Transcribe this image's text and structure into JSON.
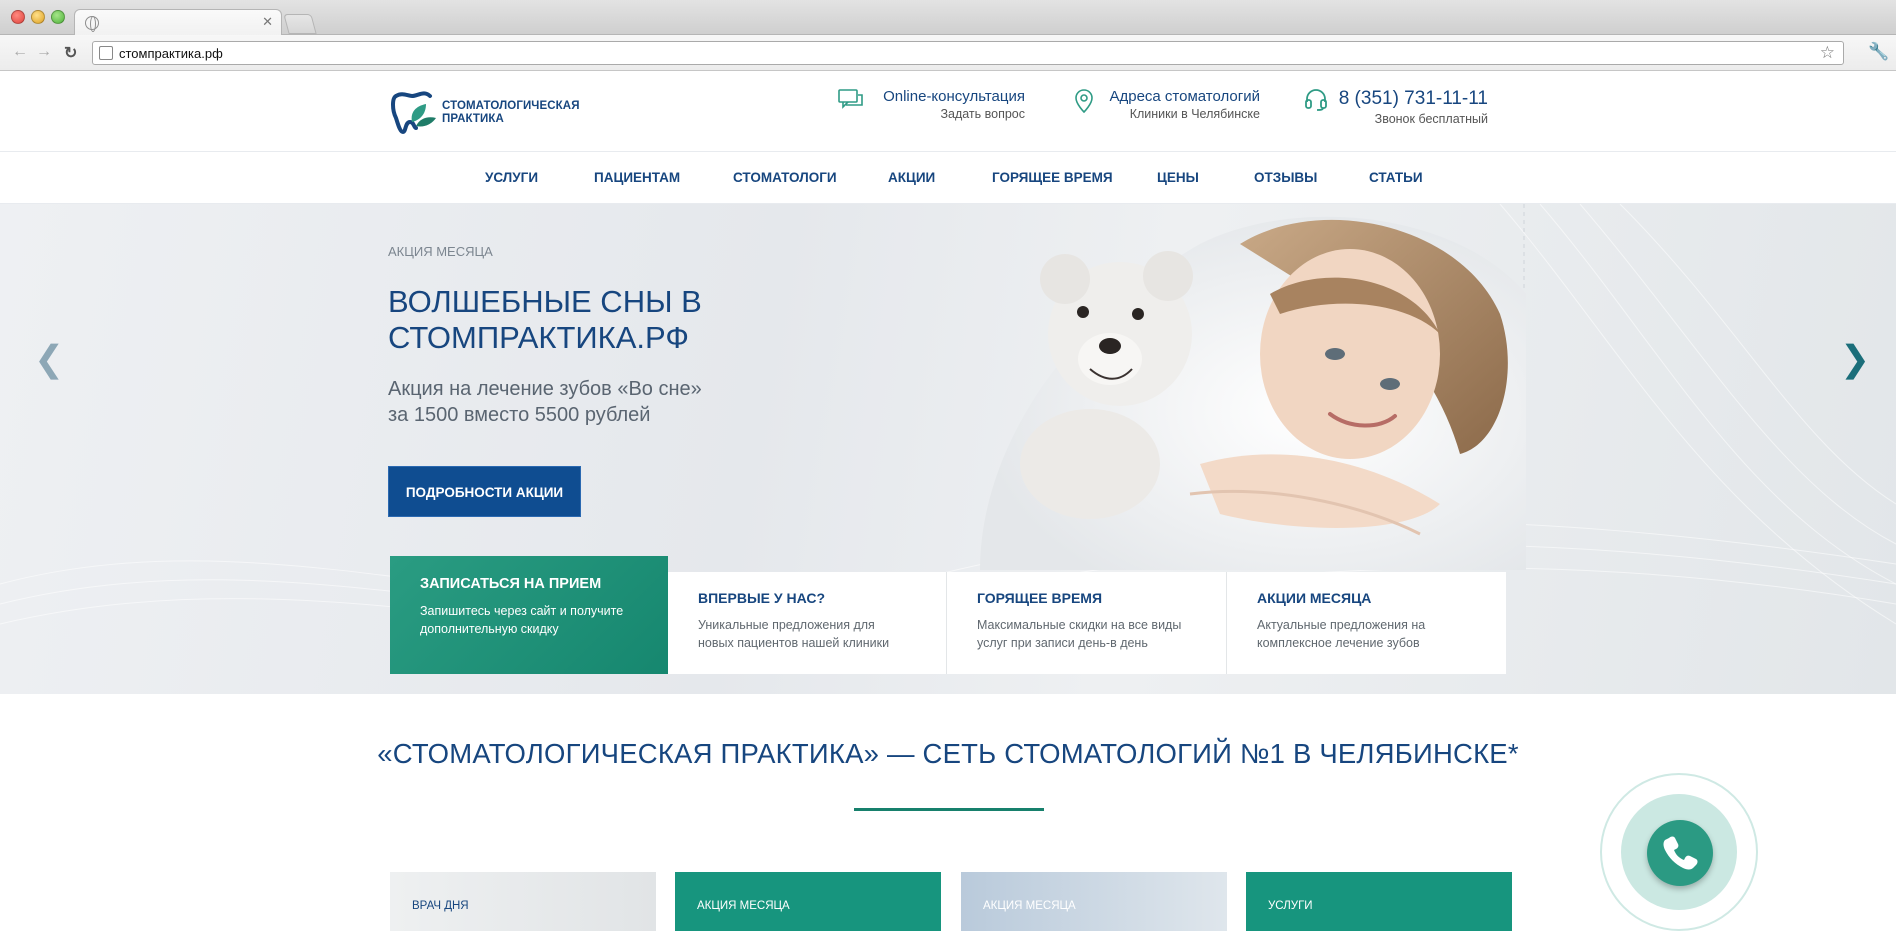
{
  "browser": {
    "url": "стомпрактика.рф"
  },
  "site": {
    "logo_line1": "СТОМАТОЛОГИЧЕСКАЯ",
    "logo_line2": "ПРАКТИКА",
    "contacts": [
      {
        "title": "Online-консультация",
        "sub": "Задать вопрос",
        "icon": "chat-icon"
      },
      {
        "title": "Адреса стоматологий",
        "sub": "Клиники в Челябинске",
        "icon": "map-pin-icon"
      },
      {
        "title": "8 (351) 731-11-11",
        "sub": "Звонок бесплатный",
        "icon": "headset-icon"
      }
    ],
    "nav": [
      "УСЛУГИ",
      "ПАЦИЕНТАМ",
      "СТОМАТОЛОГИ",
      "АКЦИИ",
      "ГОРЯЩЕЕ ВРЕМЯ",
      "ЦЕНЫ",
      "ОТЗЫВЫ",
      "СТАТЬИ"
    ]
  },
  "hero": {
    "label": "АКЦИЯ МЕСЯЦА",
    "title_line1": "ВОЛШЕБНЫЕ СНЫ В",
    "title_line2": "СТОМПРАКТИКА.РФ",
    "text_line1": "Акция на лечение зубов «Во сне»",
    "text_line2": "за 1500 вместо 5500 рублей",
    "button": "ПОДРОБНОСТИ АКЦИИ",
    "prev_arrow": "❮",
    "next_arrow": "❯"
  },
  "cards": [
    {
      "title": "ЗАПИСАТЬСЯ НА ПРИЕМ",
      "line1": "Запишитесь через сайт и получите",
      "line2": "дополнительную скидку"
    },
    {
      "title": "ВПЕРВЫЕ У НАС?",
      "line1": "Уникальные предложения для",
      "line2": "новых пациентов нашей клиники"
    },
    {
      "title": "ГОРЯЩЕЕ ВРЕМЯ",
      "line1": "Максимальные скидки на все виды",
      "line2": "услуг при записи день-в день"
    },
    {
      "title": "АКЦИИ МЕСЯЦА",
      "line1": "Актуальные предложения на",
      "line2": "комплексное лечение зубов"
    }
  ],
  "headline": "«СТОМАТОЛОГИЧЕСКАЯ ПРАКТИКА» — СЕТЬ СТОМАТОЛОГИЙ №1 В ЧЕЛЯБИНСКЕ*",
  "tiles": [
    "ВРАЧ ДНЯ",
    "АКЦИЯ МЕСЯЦА",
    "АКЦИЯ МЕСЯЦА",
    "УСЛУГИ"
  ],
  "colors": {
    "brand_blue": "#17467f",
    "brand_green": "#17957e",
    "button_blue": "#0f4d91"
  }
}
